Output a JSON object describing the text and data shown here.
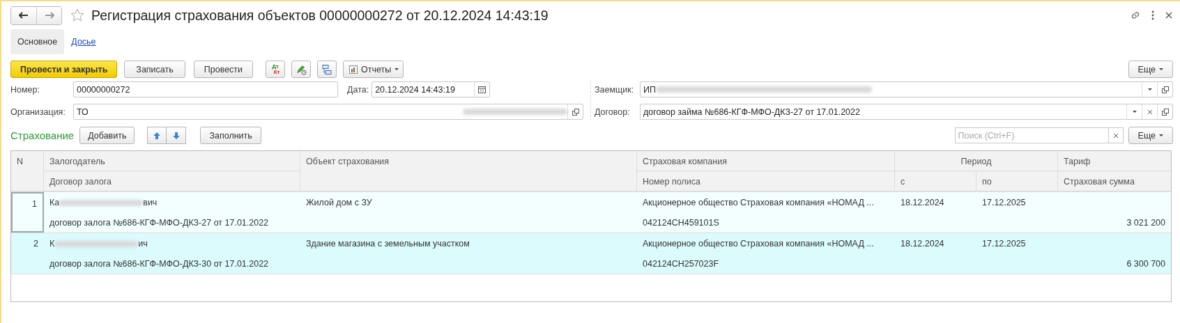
{
  "window": {
    "title": "Регистрация страхования объектов 00000000272 от 20.12.2024 14:43:19",
    "favorite": false
  },
  "tabs": [
    {
      "label": "Основное",
      "selected": true
    },
    {
      "label": "Досье",
      "selected": false
    }
  ],
  "toolbar": {
    "primary": "Провести и закрыть",
    "buttons": [
      "Записать",
      "Провести"
    ],
    "dt": "Дт",
    "kt": "Кт",
    "reports": "Отчеты",
    "more": "Еще"
  },
  "fields": {
    "number": {
      "label": "Номер:",
      "value": "00000000272"
    },
    "date": {
      "label": "Дата:",
      "value": "20.12.2024 14:43:19"
    },
    "organization": {
      "label": "Организация:",
      "value": "ТО"
    },
    "borrower": {
      "label": "Заемщик:",
      "value": "ИП"
    },
    "contract": {
      "label": "Договор:",
      "value": "договор займа №686-КГФ-МФО-ДКЗ-27 от 17.01.2022"
    }
  },
  "section": {
    "title": "Страхование",
    "add": "Добавить",
    "fill": "Заполнить",
    "search_placeholder": "Поиск (Ctrl+F)",
    "more": "Еще"
  },
  "table": {
    "columns": {
      "n": "N",
      "pledger": "Залогодатель",
      "pledge_contract": "Договор залога",
      "object": "Объект страхования",
      "company": "Страховая компания",
      "policy": "Номер полиса",
      "period": "Период",
      "from": "с",
      "to": "по",
      "tariff": "Тариф",
      "sum": "Страховая сумма"
    },
    "rows": [
      {
        "n": "1",
        "pledger_start": "Ка",
        "pledger_end": "вич",
        "pledge_contract": "договор залога №686-КГФ-МФО-ДКЗ-27 от 17.01.2022",
        "object": "Жилой дом с ЗУ",
        "company": "Акционерное общество Страховая компания «НОМАД ...",
        "policy": "042124CH459101S",
        "from": "18.12.2024",
        "to": "17.12.2025",
        "sum": "3 021 200",
        "selected": false,
        "focused": true
      },
      {
        "n": "2",
        "pledger_start": "К",
        "pledger_end": "ич",
        "pledge_contract": "договор залога №686-КГФ-МФО-ДКЗ-30 от 17.01.2022",
        "object": "Здание магазина с земельным участком",
        "company": "Акционерное общество Страховая компания «НОМАД ...",
        "policy": "042124CH257023F",
        "from": "18.12.2024",
        "to": "17.12.2025",
        "sum": "6 300 700",
        "selected": true,
        "focused": false
      }
    ]
  }
}
